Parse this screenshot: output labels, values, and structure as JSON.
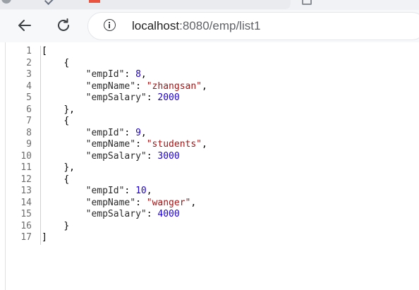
{
  "browser": {
    "url_host": "localhost",
    "url_rest": ":8080/emp/list1"
  },
  "json_view": {
    "lines": [
      {
        "n": "1",
        "indent": "",
        "parts": [
          {
            "t": "[",
            "c": "punc"
          }
        ]
      },
      {
        "n": "2",
        "indent": "    ",
        "parts": [
          {
            "t": "{",
            "c": "punc"
          }
        ]
      },
      {
        "n": "3",
        "indent": "        ",
        "parts": [
          {
            "t": "\"empId\"",
            "c": "key"
          },
          {
            "t": ": ",
            "c": "punc"
          },
          {
            "t": "8",
            "c": "num"
          },
          {
            "t": ",",
            "c": "punc"
          }
        ]
      },
      {
        "n": "4",
        "indent": "        ",
        "parts": [
          {
            "t": "\"empName\"",
            "c": "key"
          },
          {
            "t": ": ",
            "c": "punc"
          },
          {
            "t": "\"zhangsan\"",
            "c": "str"
          },
          {
            "t": ",",
            "c": "punc"
          }
        ]
      },
      {
        "n": "5",
        "indent": "        ",
        "parts": [
          {
            "t": "\"empSalary\"",
            "c": "key"
          },
          {
            "t": ": ",
            "c": "punc"
          },
          {
            "t": "2000",
            "c": "num"
          }
        ]
      },
      {
        "n": "6",
        "indent": "    ",
        "parts": [
          {
            "t": "},",
            "c": "punc"
          }
        ]
      },
      {
        "n": "7",
        "indent": "    ",
        "parts": [
          {
            "t": "{",
            "c": "punc"
          }
        ]
      },
      {
        "n": "8",
        "indent": "        ",
        "parts": [
          {
            "t": "\"empId\"",
            "c": "key"
          },
          {
            "t": ": ",
            "c": "punc"
          },
          {
            "t": "9",
            "c": "num"
          },
          {
            "t": ",",
            "c": "punc"
          }
        ]
      },
      {
        "n": "9",
        "indent": "        ",
        "parts": [
          {
            "t": "\"empName\"",
            "c": "key"
          },
          {
            "t": ": ",
            "c": "punc"
          },
          {
            "t": "\"students\"",
            "c": "str"
          },
          {
            "t": ",",
            "c": "punc"
          }
        ]
      },
      {
        "n": "10",
        "indent": "        ",
        "parts": [
          {
            "t": "\"empSalary\"",
            "c": "key"
          },
          {
            "t": ": ",
            "c": "punc"
          },
          {
            "t": "3000",
            "c": "num"
          }
        ]
      },
      {
        "n": "11",
        "indent": "    ",
        "parts": [
          {
            "t": "},",
            "c": "punc"
          }
        ]
      },
      {
        "n": "12",
        "indent": "    ",
        "parts": [
          {
            "t": "{",
            "c": "punc"
          }
        ]
      },
      {
        "n": "13",
        "indent": "        ",
        "parts": [
          {
            "t": "\"empId\"",
            "c": "key"
          },
          {
            "t": ": ",
            "c": "punc"
          },
          {
            "t": "10",
            "c": "num"
          },
          {
            "t": ",",
            "c": "punc"
          }
        ]
      },
      {
        "n": "14",
        "indent": "        ",
        "parts": [
          {
            "t": "\"empName\"",
            "c": "key"
          },
          {
            "t": ": ",
            "c": "punc"
          },
          {
            "t": "\"wanger\"",
            "c": "str"
          },
          {
            "t": ",",
            "c": "punc"
          }
        ]
      },
      {
        "n": "15",
        "indent": "        ",
        "parts": [
          {
            "t": "\"empSalary\"",
            "c": "key"
          },
          {
            "t": ": ",
            "c": "punc"
          },
          {
            "t": "4000",
            "c": "num"
          }
        ]
      },
      {
        "n": "16",
        "indent": "    ",
        "parts": [
          {
            "t": "}",
            "c": "punc"
          }
        ]
      },
      {
        "n": "17",
        "indent": "",
        "parts": [
          {
            "t": "]",
            "c": "punc"
          }
        ]
      }
    ]
  },
  "icons": {
    "back": "arrow-left-icon",
    "reload": "reload-icon",
    "info": "info-icon"
  }
}
